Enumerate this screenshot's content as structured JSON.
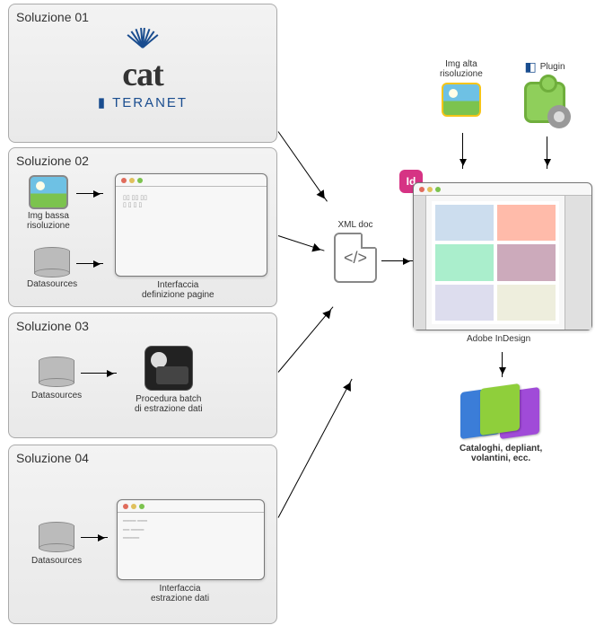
{
  "panels": {
    "p1": {
      "title": "Soluzione 01",
      "brand_main": "cat",
      "brand_sub": "TERANET"
    },
    "p2": {
      "title": "Soluzione 02",
      "img_label": "Img bassa\nrisoluzione",
      "db_label": "Datasources",
      "ui_label": "Interfaccia\ndefinizione pagine"
    },
    "p3": {
      "title": "Soluzione 03",
      "db_label": "Datasources",
      "proc_label": "Procedura batch\ndi estrazione dati"
    },
    "p4": {
      "title": "Soluzione 04",
      "db_label": "Datasources",
      "ui_label": "Interfaccia\nestrazione dati"
    }
  },
  "center": {
    "xml_label": "XML doc"
  },
  "right": {
    "img_hi_label": "Img alta\nrisoluzione",
    "plugin_label": "Plugin",
    "indesign_label": "Adobe InDesign",
    "output_label": "Cataloghi, depliant,\nvolantini, ecc."
  }
}
